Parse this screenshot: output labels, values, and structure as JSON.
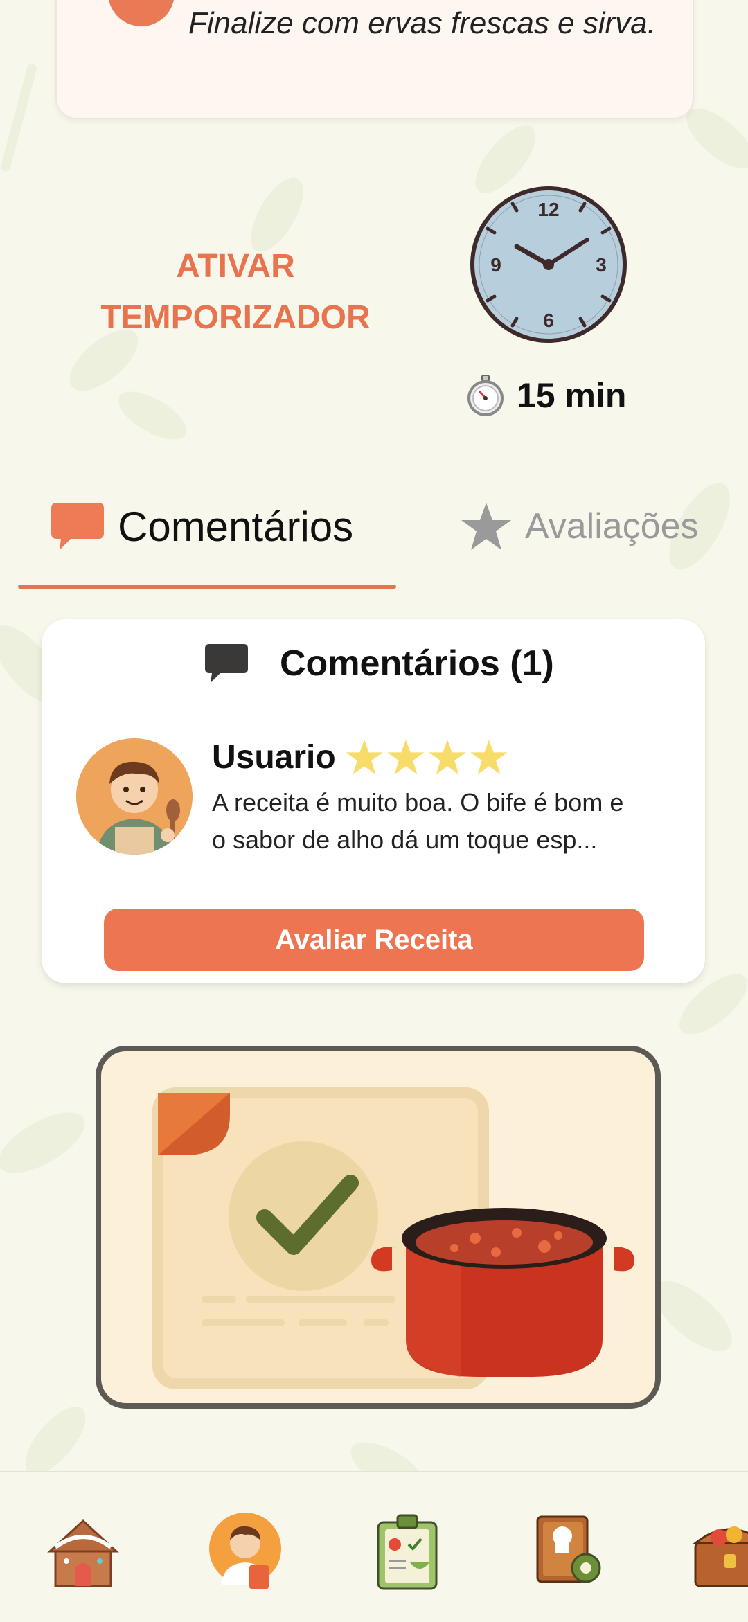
{
  "step": {
    "text": "Finalize com ervas frescas e sirva."
  },
  "timer": {
    "button_label": "ATIVAR TEMPORIZADOR",
    "duration": "15 min",
    "clock_icon": "clock-icon",
    "stopwatch_icon": "stopwatch-icon"
  },
  "tabs": [
    {
      "label": "Comentários",
      "icon": "speech-bubble-icon",
      "active": true
    },
    {
      "label": "Avaliações",
      "icon": "star-icon",
      "active": false
    }
  ],
  "comments": {
    "title": "Comentários (1)",
    "items": [
      {
        "user": "Usuario",
        "rating": 4,
        "text": "A receita é muito boa. O bife é bom e o sabor de alho dá um toque esp..."
      }
    ],
    "rate_button": "Avaliar Receita"
  },
  "nav": [
    {
      "icon": "gingerbread-house-icon"
    },
    {
      "icon": "chef-profile-icon"
    },
    {
      "icon": "checklist-clipboard-icon"
    },
    {
      "icon": "recipe-book-settings-icon"
    },
    {
      "icon": "treasure-chest-icon"
    }
  ],
  "colors": {
    "accent": "#e8744f",
    "background": "#f8f7ec",
    "star": "#f7dc6a"
  }
}
